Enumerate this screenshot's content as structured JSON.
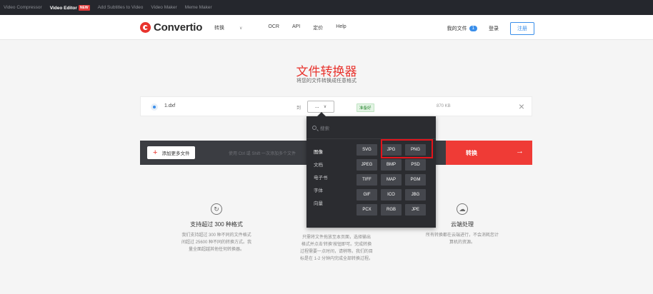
{
  "topnav": {
    "links": [
      "Video Compressor",
      "Video Editor",
      "Add Subtitles to Video",
      "Video Maker",
      "Meme Maker"
    ],
    "new_badge": "NEW"
  },
  "header": {
    "logo_text": "Convertio",
    "nav": [
      "转换",
      "OCR",
      "API",
      "定价",
      "Help"
    ],
    "my_files_label": "我的文件",
    "my_files_count": "1",
    "login_label": "登录",
    "signup_label": "注册"
  },
  "hero": {
    "title": "文件转换器",
    "subtitle": "将您的文件转换成任意格式"
  },
  "file": {
    "name": "1.dxf",
    "to_label": "到",
    "selected_format": "...",
    "status": "准备好",
    "size": "870 KB"
  },
  "action": {
    "add_files": "添加更多文件",
    "hint": "使用 Ctrl 或 Shift 一次添加多个文件",
    "convert": "转换"
  },
  "dropdown": {
    "search_placeholder": "搜索",
    "categories": [
      "图像",
      "文档",
      "电子书",
      "字体",
      "向量"
    ],
    "formats": [
      "SVG",
      "JPG",
      "PNG",
      "JPEG",
      "BMP",
      "PSD",
      "TIFF",
      "MAP",
      "PGM",
      "GIF",
      "ICO",
      "JBG",
      "PCX",
      "RGB",
      "JPE"
    ]
  },
  "features": [
    {
      "title": "支持超过 300 种格式",
      "desc": [
        "我们支持超过 300 种不同的文件格式",
        "间超过 25600 种不同的转换方式。我",
        "量全面超越其他任何转换器。"
      ]
    },
    {
      "title": "",
      "desc": [
        "只需将文件拖放至本页面，选择输出",
        "格式并点击'转换'按钮即可。完成转换",
        "过程需要一点时间，请稍等。我们的目",
        "标是在 1-2 分钟内完成全部转换过程。"
      ]
    },
    {
      "title": "云端处理",
      "desc": [
        "所有转换都在云端进行，不会消耗您计",
        "算机的资源。"
      ]
    }
  ],
  "colors": {
    "brand_red": "#e8332d",
    "convert_red": "#ef3b36",
    "dark_panel": "#2b2c30",
    "link_blue": "#3a8eea"
  }
}
